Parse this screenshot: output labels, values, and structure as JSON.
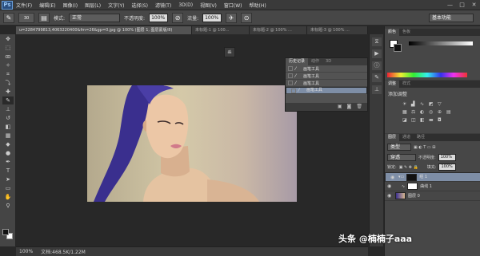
{
  "app": {
    "logo": "Ps"
  },
  "menu": [
    "文件(F)",
    "编辑(E)",
    "图像(I)",
    "图层(L)",
    "文字(Y)",
    "选择(S)",
    "滤镜(T)",
    "3D(D)",
    "视图(V)",
    "窗口(W)",
    "帮助(H)"
  ],
  "window_controls": [
    "—",
    "□",
    "✕"
  ],
  "options": {
    "brush_size": "30",
    "mode_label": "模式:",
    "mode_value": "正常",
    "opacity_label": "不透明度:",
    "opacity_value": "100%",
    "flow_label": "流量:",
    "flow_value": "100%",
    "workspace": "基本功能"
  },
  "tabs": [
    {
      "label": "u=2284799813,4063220400&fm=26&gp=0.jpg @ 100% (图层 1, 图层蒙版/8)",
      "active": true
    },
    {
      "label": "未标题-1 @ 100...",
      "active": false
    },
    {
      "label": "未标题-2 @ 100% ...",
      "active": false
    },
    {
      "label": "未标题-3 @ 100% ...",
      "active": false
    }
  ],
  "history": {
    "tabs": [
      "历史记录",
      "动作",
      "3D"
    ],
    "items": [
      "画笔工具",
      "画笔工具",
      "画笔工具",
      "画笔工具"
    ]
  },
  "status": {
    "zoom": "100%",
    "doc": "文档:468.5K/1.22M"
  },
  "color_panel": {
    "tabs": [
      "颜色",
      "色板"
    ]
  },
  "adjust_panel": {
    "tabs": [
      "调整",
      "样式"
    ],
    "title": "添加调整"
  },
  "layers_panel": {
    "tabs": [
      "图层",
      "通道",
      "路径"
    ],
    "filter": "类型",
    "blend": "穿透",
    "opacity_label": "不透明度:",
    "opacity": "100%",
    "lock_label": "锁定:",
    "fill_label": "填充:",
    "fill": "100%",
    "layers": [
      {
        "name": "组 1",
        "selected": true
      },
      {
        "name": "曲线 1",
        "selected": false
      },
      {
        "name": "图层 0",
        "selected": false
      }
    ]
  },
  "watermark": "头条 @楠楠子aaa"
}
